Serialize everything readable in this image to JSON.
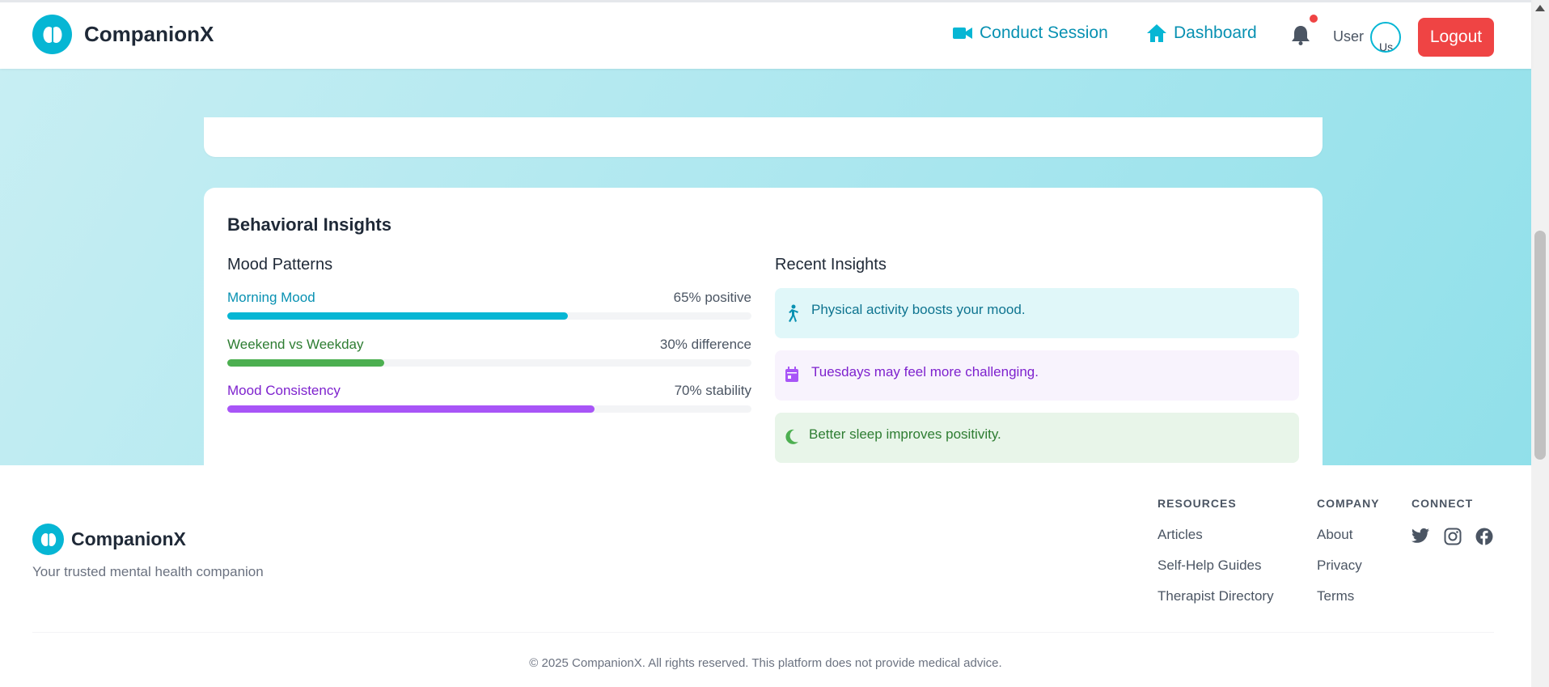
{
  "header": {
    "brand": "CompanionX",
    "nav": {
      "conduct_session": "Conduct Session",
      "dashboard": "Dashboard"
    },
    "user_label": "User",
    "avatar_alt": "Us",
    "logout": "Logout"
  },
  "insights": {
    "title": "Behavioral Insights",
    "mood_patterns": {
      "title": "Mood Patterns",
      "bars": [
        {
          "label": "Morning Mood",
          "value_text": "65% positive",
          "value": 0.65,
          "color": "#06b6d4",
          "label_color": "#0891b2"
        },
        {
          "label": "Weekend vs Weekday",
          "value_text": "30% difference",
          "value": 0.3,
          "color": "#4caf50",
          "label_color": "#2e7d32"
        },
        {
          "label": "Mood Consistency",
          "value_text": "70% stability",
          "value": 0.7,
          "color": "#a855f7",
          "label_color": "#7e22ce"
        }
      ]
    },
    "recent": {
      "title": "Recent Insights",
      "items": [
        {
          "text": "Physical activity boosts your mood.",
          "icon": "running-icon",
          "bg": "#e0f7f9",
          "color": "#0e7490"
        },
        {
          "text": "Tuesdays may feel more challenging.",
          "icon": "calendar-icon",
          "bg": "#f8f3fd",
          "color": "#7e22ce"
        },
        {
          "text": "Better sleep improves positivity.",
          "icon": "moon-icon",
          "bg": "#e8f5e9",
          "color": "#2e7d32"
        }
      ]
    }
  },
  "footer": {
    "brand": "CompanionX",
    "tagline": "Your trusted mental health companion",
    "resources": {
      "heading": "RESOURCES",
      "links": [
        "Articles",
        "Self-Help Guides",
        "Therapist Directory"
      ]
    },
    "company": {
      "heading": "COMPANY",
      "links": [
        "About",
        "Privacy",
        "Terms"
      ]
    },
    "connect": {
      "heading": "CONNECT",
      "icons": [
        "twitter-icon",
        "instagram-icon",
        "facebook-icon"
      ]
    },
    "copyright": "© 2025 CompanionX. All rights reserved. This platform does not provide medical advice."
  },
  "colors": {
    "accent": "#06b6d4",
    "danger": "#ef4444"
  }
}
